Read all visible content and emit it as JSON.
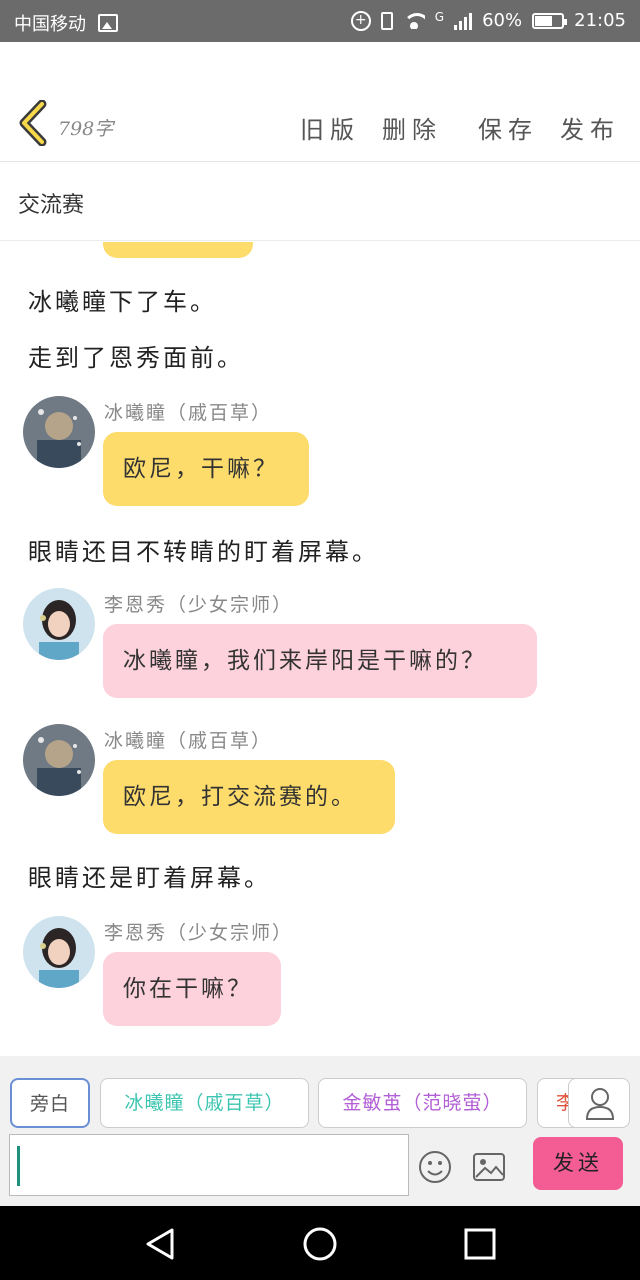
{
  "status_bar": {
    "carrier": "中国移动",
    "network": "G",
    "battery": "60%",
    "time": "21:05"
  },
  "header": {
    "word_count": "798字",
    "actions": [
      "旧版",
      "删除",
      "保存",
      "发布"
    ]
  },
  "title": "交流赛",
  "messages": [
    {
      "type": "narration",
      "text": "冰曦瞳下了车。"
    },
    {
      "type": "narration",
      "text": "走到了恩秀面前。"
    },
    {
      "type": "speech",
      "speaker": "冰曦瞳（戚百草）",
      "text": "欧尼，干嘛？",
      "color": "yellow"
    },
    {
      "type": "narration",
      "text": "眼睛还目不转睛的盯着屏幕。"
    },
    {
      "type": "speech",
      "speaker": "李恩秀（少女宗师）",
      "text": "冰曦瞳，我们来岸阳是干嘛的？",
      "color": "pink"
    },
    {
      "type": "speech",
      "speaker": "冰曦瞳（戚百草）",
      "text": "欧尼，打交流赛的。",
      "color": "yellow"
    },
    {
      "type": "narration",
      "text": "眼睛还是盯着屏幕。"
    },
    {
      "type": "speech",
      "speaker": "李恩秀（少女宗师）",
      "text": "你在干嘛？",
      "color": "pink"
    }
  ],
  "composer": {
    "roles": [
      {
        "label": "旁白",
        "color": "#555555"
      },
      {
        "label": "冰曦瞳（戚百草）",
        "color": "#3cc5b0"
      },
      {
        "label": "金敏茧（范晓萤）",
        "color": "#b35fd6"
      },
      {
        "label": "李",
        "color": "#e0533b"
      }
    ],
    "input_value": "",
    "send_label": "发送"
  },
  "colors": {
    "bubble_yellow": "#fddc6c",
    "bubble_pink": "#fdd2dd",
    "send": "#f45c94"
  }
}
